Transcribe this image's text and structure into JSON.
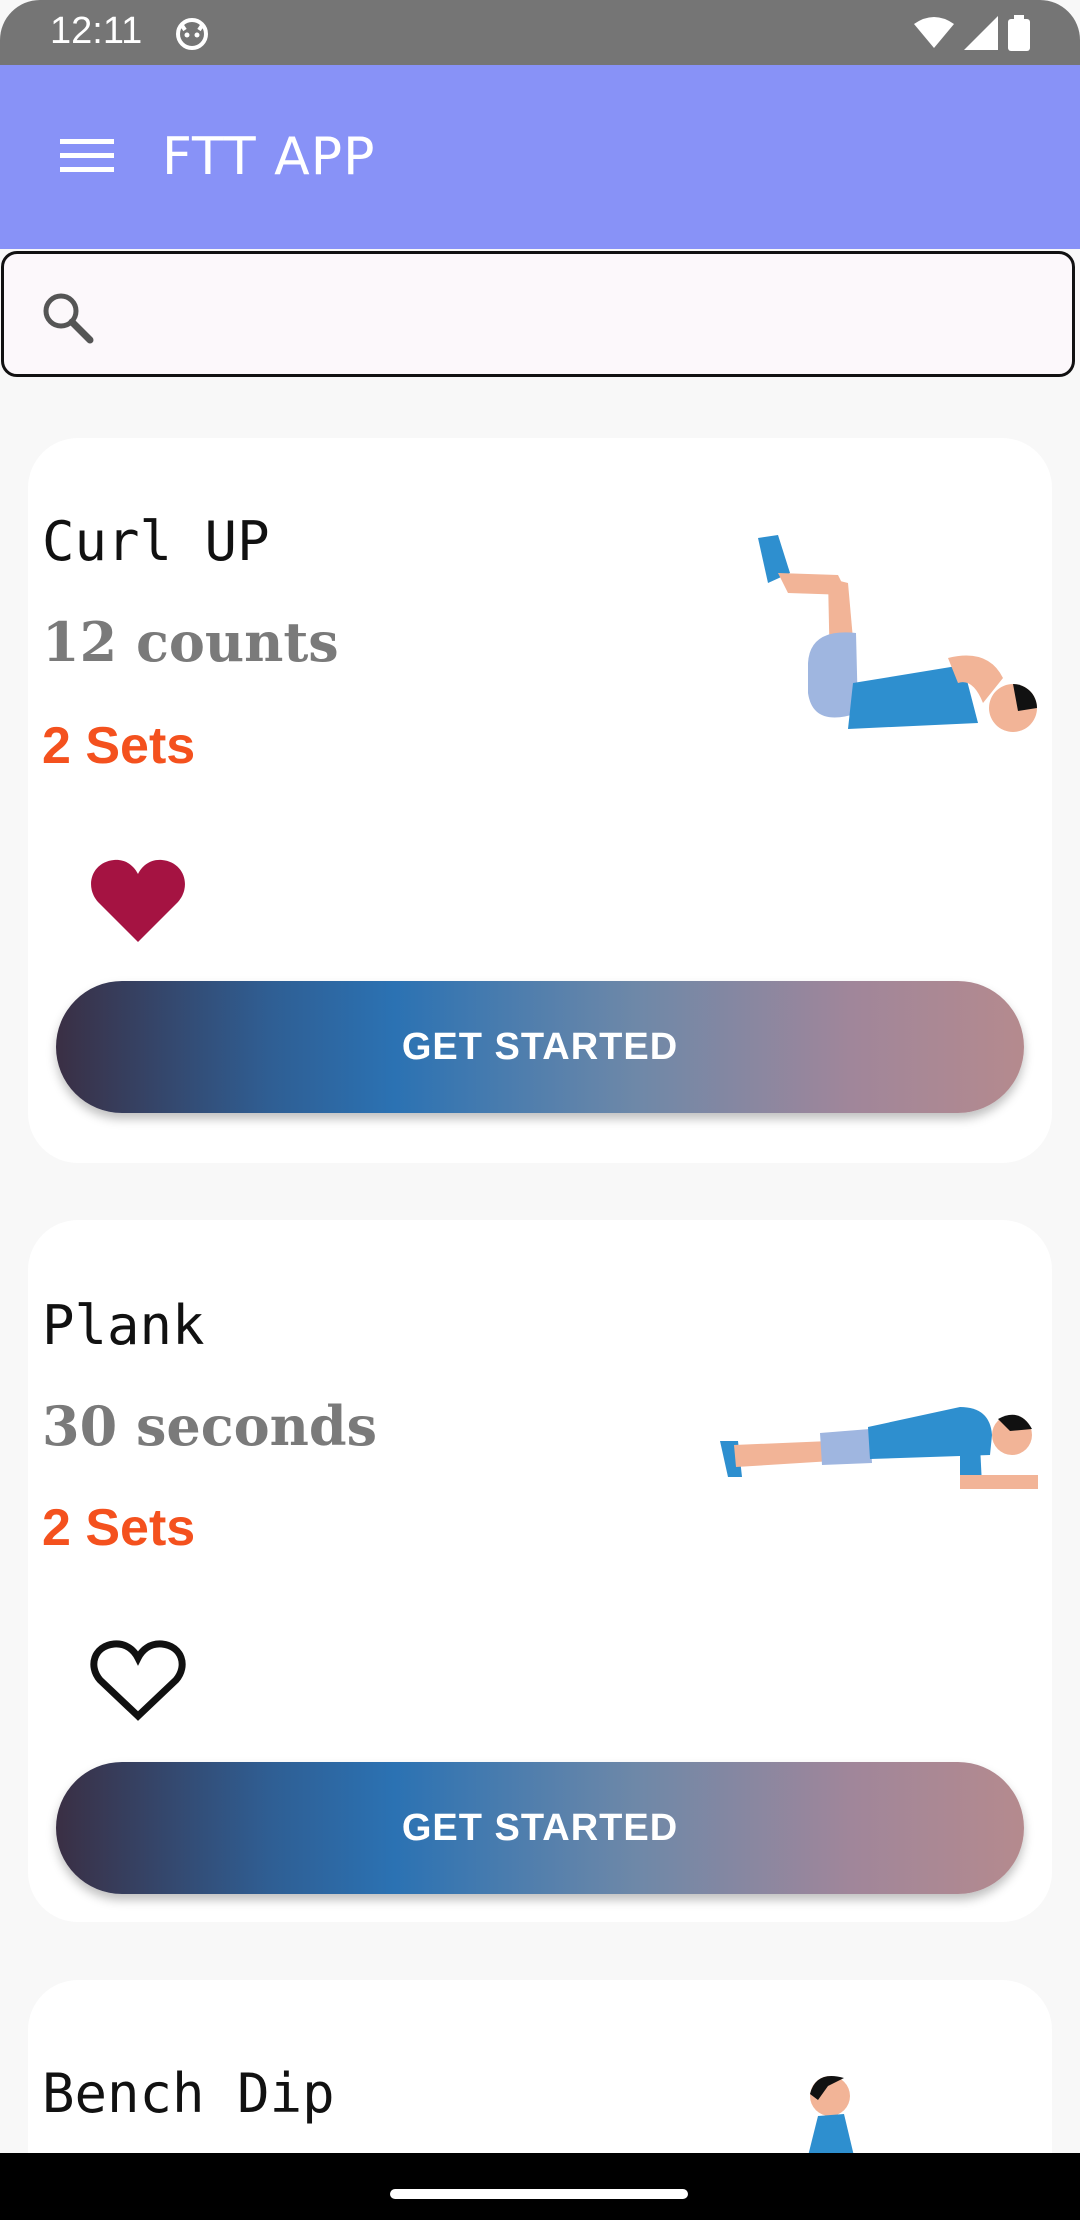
{
  "status_bar": {
    "time": "12:11",
    "icons": [
      "cat-icon",
      "wifi-icon",
      "signal-icon",
      "battery-icon"
    ]
  },
  "app_bar": {
    "title": "FTT APP",
    "menu_icon": "hamburger-menu-icon",
    "color": "#8892f7"
  },
  "search": {
    "placeholder": "",
    "value": "",
    "icon": "search-icon"
  },
  "exercises": [
    {
      "name": "Curl UP",
      "amount": "12 counts",
      "sets": "2 Sets",
      "favorite": true,
      "button_label": "GET STARTED",
      "illustration": "curl-up-figure"
    },
    {
      "name": "Plank",
      "amount": "30 seconds",
      "sets": "2 Sets",
      "favorite": false,
      "button_label": "GET STARTED",
      "illustration": "plank-figure"
    },
    {
      "name": "Bench Dip",
      "illustration": "bench-dip-figure"
    }
  ],
  "colors": {
    "sets": "#f4511e",
    "favorite_filled": "#a51342",
    "amount": "#7a7a7a"
  }
}
